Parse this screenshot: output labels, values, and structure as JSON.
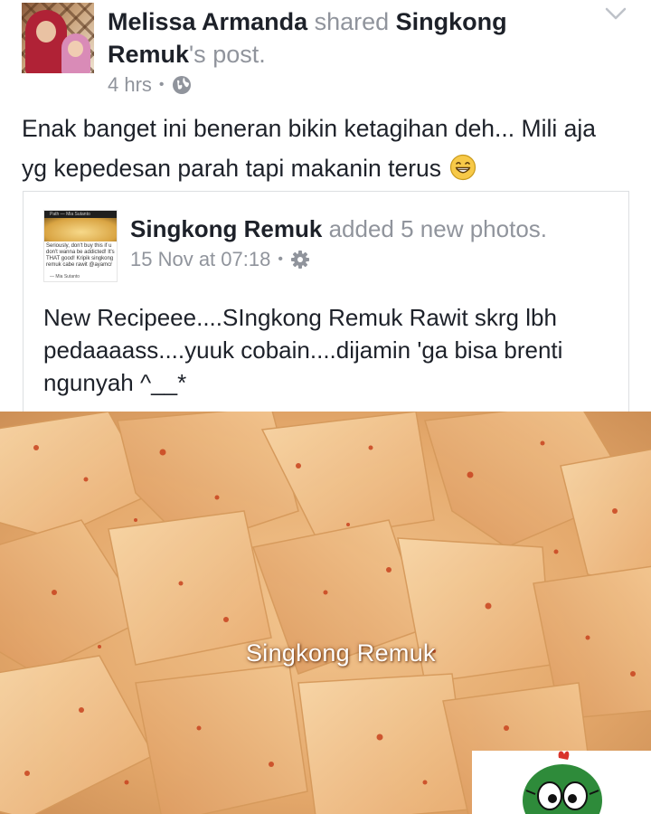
{
  "header": {
    "sharer_name": "Melissa Armanda",
    "shared_word": " shared ",
    "page_name": "Singkong",
    "page_name_line2": "Remuk",
    "post_suffix": "'s post.",
    "time": "4 hrs",
    "separator": "•",
    "privacy_icon": "globe-icon",
    "menu_icon": "chevron-down-icon"
  },
  "post": {
    "text_line1": "Enak banget ini beneran bikin ketagihan deh... Mili aja",
    "text_line2": "yg kepedesan parah tapi makanin terus",
    "emoji": "grinning-face-icon"
  },
  "shared_post": {
    "thumbnail": {
      "bar_text": "Path — Mia Sutanto",
      "caption": "Seriously, don't buy this if u don't wanna be addicted! It's THAT good! Kripik singkong remuk cabe rawit @ayamcr",
      "signature": "— Mia Sutanto"
    },
    "page_name": "Singkong Remuk",
    "action": " added 5 new photos.",
    "date": "15 Nov at 07:18",
    "separator": "•",
    "audience_icon": "gear-icon",
    "text_line1": "New Recipeee....SIngkong Remuk Rawit skrg lbh",
    "text_line2": "pedaaaass....yuuk cobain....dijamin 'ga bisa brenti",
    "text_line3": "ngunyah ^__*"
  },
  "photo": {
    "watermark": "Singkong Remuk",
    "colors": {
      "base": "#e9b27a",
      "chip_light": "#f6cf9c",
      "chip_mid": "#eeb57c",
      "chili": "#c8431f"
    }
  }
}
